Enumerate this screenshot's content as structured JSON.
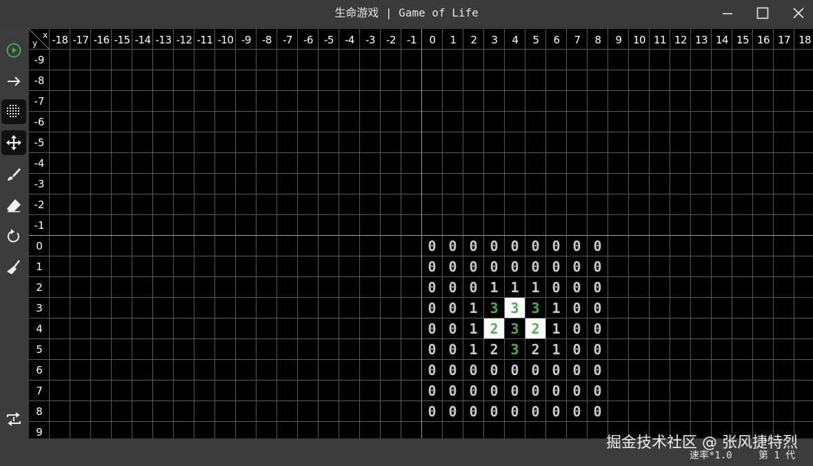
{
  "window": {
    "title": "生命游戏 | Game of Life",
    "buttons": [
      "minimize",
      "maximize",
      "close"
    ]
  },
  "toolbar": {
    "tools": [
      {
        "name": "play-icon",
        "active": false
      },
      {
        "name": "step-arrow-icon",
        "active": false
      },
      {
        "name": "grid-toggle-icon",
        "active": true
      },
      {
        "name": "move-icon",
        "active": true
      },
      {
        "name": "brush-icon",
        "active": false
      },
      {
        "name": "eraser-icon",
        "active": false
      },
      {
        "name": "reset-icon",
        "active": false
      },
      {
        "name": "clear-broom-icon",
        "active": false
      },
      {
        "name": "random-icon",
        "active": false
      }
    ]
  },
  "board": {
    "corner_x": "x",
    "corner_y": "y",
    "x_labels": [
      "-18",
      "-17",
      "-16",
      "-15",
      "-14",
      "-13",
      "-12",
      "-11",
      "-10",
      "-9",
      "-8",
      "-7",
      "-6",
      "-5",
      "-4",
      "-3",
      "-2",
      "-1",
      "0",
      "1",
      "2",
      "3",
      "4",
      "5",
      "6",
      "7",
      "8",
      "9",
      "10",
      "11",
      "12",
      "13",
      "14",
      "15",
      "16",
      "17",
      "18"
    ],
    "y_labels": [
      "-9",
      "-8",
      "-7",
      "-6",
      "-5",
      "-4",
      "-3",
      "-2",
      "-1",
      "0",
      "1",
      "2",
      "3",
      "4",
      "5",
      "6",
      "7",
      "8",
      "9"
    ],
    "neighbor_counts": [
      [
        0,
        0,
        0,
        0,
        0,
        0,
        0,
        0,
        0
      ],
      [
        0,
        0,
        0,
        0,
        0,
        0,
        0,
        0,
        0
      ],
      [
        0,
        0,
        0,
        1,
        1,
        1,
        0,
        0,
        0
      ],
      [
        0,
        0,
        1,
        3,
        3,
        3,
        1,
        0,
        0
      ],
      [
        0,
        0,
        1,
        2,
        3,
        2,
        1,
        0,
        0
      ],
      [
        0,
        0,
        1,
        2,
        3,
        2,
        1,
        0,
        0
      ],
      [
        0,
        0,
        0,
        0,
        0,
        0,
        0,
        0,
        0
      ],
      [
        0,
        0,
        0,
        0,
        0,
        0,
        0,
        0,
        0
      ],
      [
        0,
        0,
        0,
        0,
        0,
        0,
        0,
        0,
        0
      ]
    ],
    "alive_cells": [
      [
        4,
        3
      ],
      [
        3,
        4
      ],
      [
        5,
        4
      ]
    ],
    "highlighted_cells": [
      [
        3,
        3
      ],
      [
        4,
        3
      ],
      [
        5,
        3
      ],
      [
        3,
        4
      ],
      [
        4,
        4
      ],
      [
        5,
        4
      ],
      [
        4,
        5
      ]
    ],
    "colors": {
      "grid": "#5a5a5a",
      "axis": "#3fc3c3",
      "live": "#4caf50",
      "dead_digit": "#c9c9c9"
    }
  },
  "status": {
    "speed": "速率*1.0",
    "generation": "第 1 代"
  },
  "watermark": "掘金技术社区 @ 张风捷特烈"
}
